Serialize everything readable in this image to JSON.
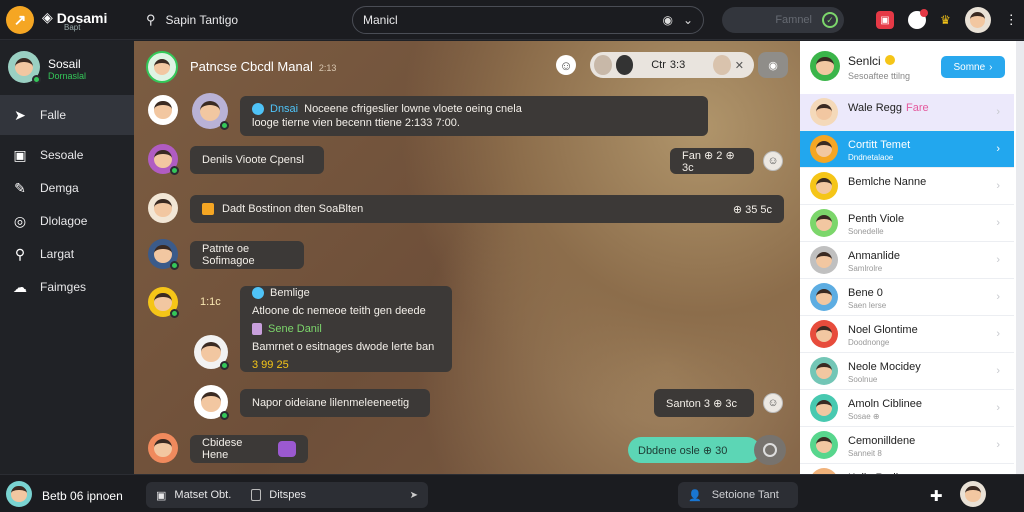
{
  "top": {
    "brand_name": "Dosami",
    "brand_sub": "Bapt",
    "search_label": "Sapin Tantigo",
    "input_value": "Manicl",
    "pill_label": "Famnel"
  },
  "sidebar": {
    "profile_name": "Sosail",
    "profile_status": "Dornaslal",
    "items": [
      {
        "label": "Falle",
        "icon": "send-icon"
      },
      {
        "label": "Sesoale",
        "icon": "chat-icon"
      },
      {
        "label": "Demga",
        "icon": "pen-icon"
      },
      {
        "label": "Dlolagoe",
        "icon": "camera-icon"
      },
      {
        "label": "Largat",
        "icon": "search-icon"
      },
      {
        "label": "Faimges",
        "icon": "cloud-icon"
      }
    ]
  },
  "chat": {
    "header_title": "Patncse Cbcdl Manal",
    "header_sub": "2:13",
    "call_text": "Ctr",
    "call_time": "3:3",
    "messages": {
      "m1_name": "Dnsai",
      "m1_line1": "Noceene cfrigeslier lowne vloete oeing cnela",
      "m1_line2": "looge tierne vien becenn ttiene 2:133 7:00.",
      "m2": "Denils Vioote Cpensl",
      "m2_react": "Fan ⊕ 2 ⊕ 3c",
      "m3": "Dadt Bostinon dten SoaBlten",
      "m3_react": "⊕ 35  5c",
      "m4": "Patnte oe Sofimagoe",
      "m5_time": "1:1c",
      "m5_name": "Bemlige",
      "m5_line1": "Atloone dc nemeoe teith gen deede",
      "m5_line2_name": "Sene Danil",
      "m5_line3": "Bamrnet o esitnages dwode lerte ban",
      "m5_footer": "3 99 25",
      "m6": "Napor oideiane lilenmeleeneetig",
      "m6_react": "Santon 3 ⊕ 3c",
      "m7": "Cbidese Hene",
      "green_button": "Dbdene osle ⊕ 30"
    }
  },
  "right_panel": {
    "header_name": "Senlci",
    "header_sub": "Sesoaftee ttilng",
    "header_button": "Somne",
    "contacts": [
      {
        "name": "Wale Regg",
        "extra": "Fare",
        "sub": "",
        "state": "light",
        "color": "#f4d9b9"
      },
      {
        "name": "Cortitt Temet",
        "extra": "",
        "sub": "Dndnetalaoe",
        "state": "selected",
        "color": "#f5a623"
      },
      {
        "name": "Bemlche Nanne",
        "extra": "",
        "sub": "",
        "state": "",
        "color": "#f5c518"
      },
      {
        "name": "Penth Viole",
        "extra": "",
        "sub": "Sonedelle",
        "state": "",
        "color": "#7cd66b"
      },
      {
        "name": "Anmanlide",
        "extra": "",
        "sub": "Samlrolre",
        "state": "",
        "color": "#c0c0c0"
      },
      {
        "name": "Bene 0",
        "extra": "",
        "sub": "Saen lerse",
        "state": "",
        "color": "#5dade2"
      },
      {
        "name": "Noel Glontime",
        "extra": "",
        "sub": "Doodnonge",
        "state": "",
        "color": "#e74c3c"
      },
      {
        "name": "Neole Mocidey",
        "extra": "",
        "sub": "Soolnue",
        "state": "",
        "color": "#73c6b6"
      },
      {
        "name": "Amoln Ciblinee",
        "extra": "",
        "sub": "Sosae ⊕",
        "state": "",
        "color": "#48c9b0"
      },
      {
        "name": "Cemonilldene",
        "extra": "",
        "sub": "Sanneit 8",
        "state": "",
        "color": "#58d68d"
      },
      {
        "name": "Keile Redl",
        "extra": "",
        "sub": "",
        "state": "",
        "color": "#f0b27a"
      }
    ]
  },
  "bottom": {
    "user_name": "Betb 06 ipnoen",
    "input_text": "Matset Obt.",
    "input_text2": "Ditspes",
    "pill_text": "Setoione Tant"
  },
  "colors": {
    "accent_blue": "#22a7ee",
    "online_green": "#34c759",
    "brand_orange": "#f5a623"
  }
}
